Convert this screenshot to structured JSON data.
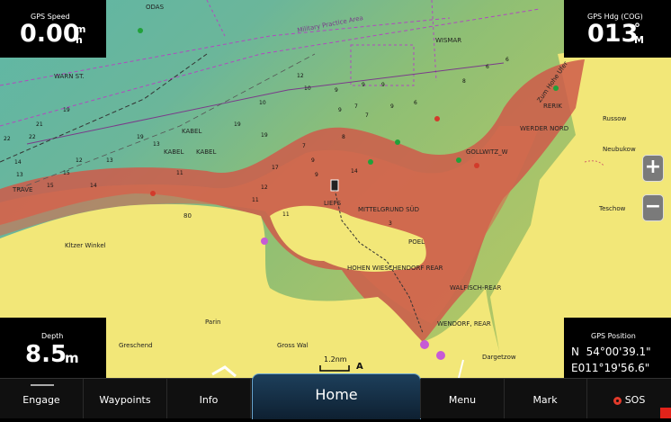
{
  "data_fields": {
    "gps_speed": {
      "label": "GPS Speed",
      "value": "0.00",
      "unit_top": "m",
      "unit_bottom": "h"
    },
    "gps_heading": {
      "label": "GPS Hdg (COG)",
      "value": "013",
      "unit_top": "°",
      "unit_bottom": "M"
    },
    "depth": {
      "label": "Depth",
      "value": "8.5",
      "unit": "m"
    },
    "gps_position": {
      "label": "GPS Position",
      "lat": "N  54°00'39.1\"",
      "lon": "E011°19'56.6\""
    }
  },
  "map": {
    "scale_label": "1.2nm",
    "place_labels": {
      "odas": "ODAS",
      "military_area": "Military Practice Area",
      "wismar": "WISMAR",
      "warn_st": "WARN ST.",
      "kabel1": "KABEL",
      "kabel2": "KABEL",
      "kabel3": "KABEL",
      "trave": "TRAVE",
      "kitzer": "Kltzer Winkel",
      "lieps": "LIEPS",
      "mittelgrund": "MITTELGRUND SÜD",
      "poel": "POEL",
      "hohen": "HOHEN WIESCHENDORF REAR",
      "walfisch": "WALFISCH-REAR",
      "wendorf": "WENDORF, REAR",
      "parin": "Parin",
      "greschend": "Greschend",
      "gross_wal": "Gross Wal",
      "dargetzow": "Dargetzow",
      "rerik": "RERIK",
      "werder": "WERDER NORD",
      "gollwitz": "GOLLWITZ_W",
      "russow": "Russow",
      "neubukow": "Neubukow",
      "teschow": "Teschow",
      "zum_hohe": "Zum Hohe Ufer",
      "eighty": "80"
    },
    "depth_soundings": [
      "12",
      "9",
      "19",
      "9",
      "10",
      "8",
      "9",
      "6",
      "9",
      "9",
      "7",
      "7",
      "6",
      "10",
      "21",
      "22",
      "22",
      "19",
      "19",
      "13",
      "13",
      "15",
      "14",
      "15",
      "14",
      "17",
      "19",
      "11",
      "6",
      "9",
      "7",
      "9",
      "8",
      "11",
      "12",
      "11",
      "3",
      "13",
      "14",
      "12"
    ]
  },
  "toolbar": {
    "engage": "Engage",
    "waypoints": "Waypoints",
    "info": "Info",
    "home": "Home",
    "menu": "Menu",
    "mark": "Mark",
    "sos": "SOS"
  },
  "zoom": {
    "in": "+",
    "out": "−"
  }
}
